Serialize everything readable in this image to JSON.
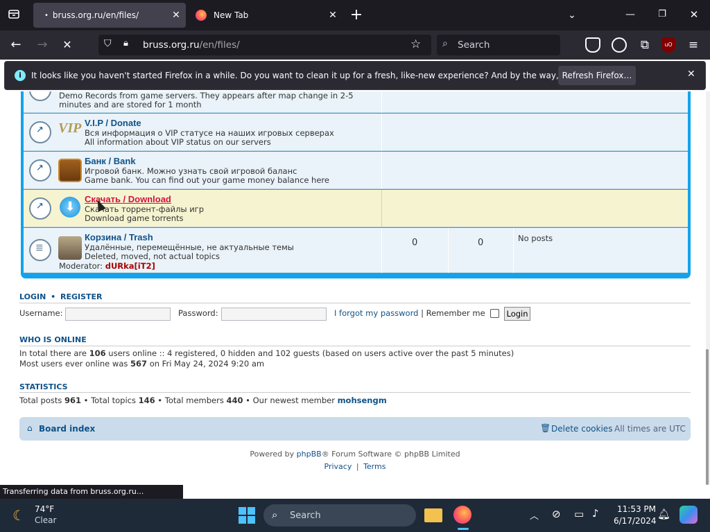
{
  "browser": {
    "tabs": [
      {
        "title": "bruss.org.ru/en/files/"
      },
      {
        "title": "New Tab"
      }
    ],
    "url_host": "bruss.org.ru",
    "url_path": "/en/files/",
    "search_placeholder": "Search",
    "notification": {
      "text": "It looks like you haven't started Firefox in a while. Do you want to clean it up for a fresh, like-new experience? And by the way, welcome back!",
      "button": "Refresh Firefox…"
    },
    "status": "Transferring data from bruss.org.ru...",
    "colors": {
      "chrome": "#1c1b22",
      "toolbar": "#2b2a33",
      "accent": "#12a3eb",
      "link": "#105289"
    }
  },
  "forums": [
    {
      "title": "",
      "desc1": "Demo Records from game servers. They appears after map change in 2-5",
      "desc2": "minutes and are stored for 1 month"
    },
    {
      "title": "V.I.P / Donate",
      "desc1": "Вся информация о VIP статусе на наших игровых серверах",
      "desc2": "All information about VIP status on our servers",
      "img": "VIP"
    },
    {
      "title": "Банк / Bank",
      "desc1": "Игровой банк. Можно узнать свой игровой баланс",
      "desc2": "Game bank. You can find out your game money balance here"
    },
    {
      "title": "Скачать / Download",
      "desc1": "Скачать торрент-файлы игр",
      "desc2": "Download game torrents"
    },
    {
      "title": "Корзина / Trash",
      "desc1": "Удалённые, перемещённые, не актуальные темы",
      "desc2": "Deleted, moved, not actual topics",
      "topics": "0",
      "posts": "0",
      "last": "No posts",
      "moderator_label": "Moderator:",
      "moderator": "dURka[iT2]"
    }
  ],
  "login": {
    "login_link": "LOGIN",
    "sep": "•",
    "register_link": "REGISTER",
    "username_label": "Username:",
    "password_label": "Password:",
    "forgot": "I forgot my password",
    "divider": "|",
    "remember": "Remember me",
    "button": "Login"
  },
  "online": {
    "heading": "WHO IS ONLINE",
    "l1a": "In total there are ",
    "total": "106",
    "l1b": " users online :: 4 registered, 0 hidden and 102 guests (based on users active over the past 5 minutes)",
    "l2a": "Most users ever online was ",
    "max": "567",
    "l2b": " on Fri May 24, 2024 9:20 am"
  },
  "stats": {
    "heading": "STATISTICS",
    "posts_label": "Total posts ",
    "posts": "961",
    "topics_label": " • Total topics ",
    "topics": "146",
    "members_label": " • Total members ",
    "members": "440",
    "newest_label": " • Our newest member ",
    "newest": "mohsengm"
  },
  "footer": {
    "board_index": "Board index",
    "delete_cookies": "Delete cookies",
    "timezone": "All times are UTC",
    "powered1": "Powered by ",
    "phpbb": "phpBB",
    "powered2": "® Forum Software © phpBB Limited",
    "privacy": "Privacy",
    "bar": "|",
    "terms": "Terms"
  },
  "taskbar": {
    "temp": "74°F",
    "weather": "Clear",
    "search": "Search",
    "time": "11:53 PM",
    "date": "6/17/2024"
  }
}
